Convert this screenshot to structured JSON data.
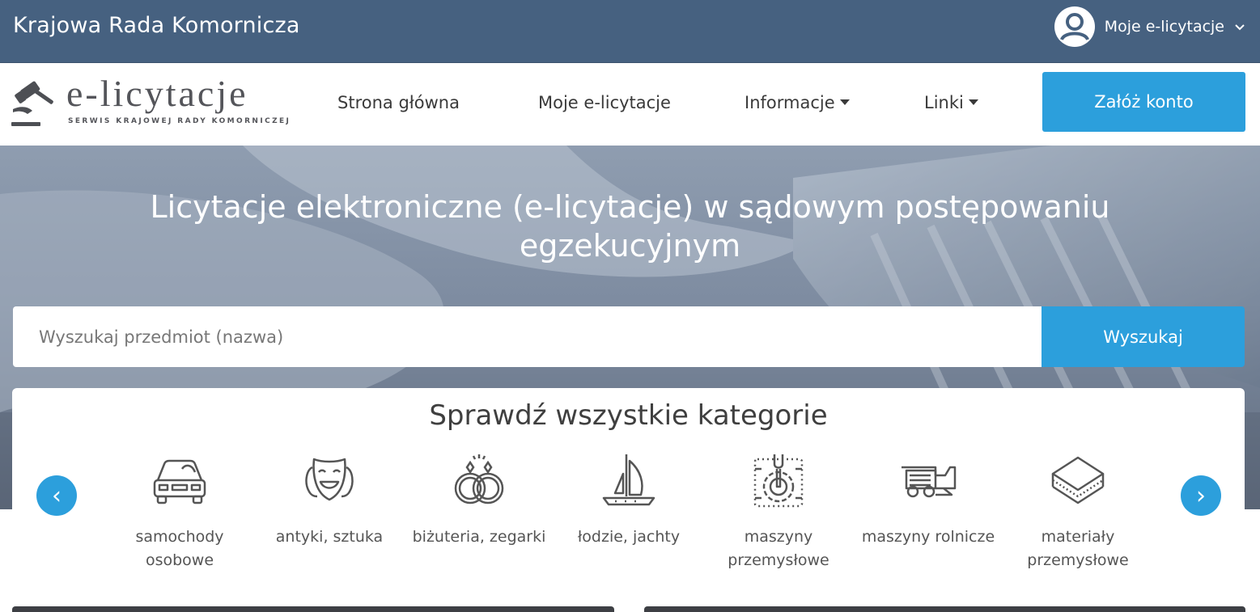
{
  "topbar": {
    "org_name": "Krajowa Rada Komornicza",
    "user_menu_label": "Moje e-licytacje",
    "avatar_icon": "user-circle-icon",
    "caret_icon": "chevron-down-icon"
  },
  "logo": {
    "wordmark": "e-licytacje",
    "tagline": "SERWIS KRAJOWEJ RADY KOMORNICZEJ",
    "icon": "gavel-icon"
  },
  "nav": {
    "items": [
      {
        "label": "Strona główna",
        "dropdown": false
      },
      {
        "label": "Moje e-licytacje",
        "dropdown": false
      },
      {
        "label": "Informacje",
        "dropdown": true
      },
      {
        "label": "Linki",
        "dropdown": true
      }
    ],
    "register_label": "Załóż konto"
  },
  "hero": {
    "title": "Licytacje elektroniczne (e-licytacje) w sądowym postępowaniu egzekucyjnym"
  },
  "search": {
    "placeholder": "Wyszukaj przedmiot (nazwa)",
    "value": "",
    "button_label": "Wyszukaj"
  },
  "categories": {
    "title": "Sprawdź wszystkie kategorie",
    "prev_label": "‹",
    "next_label": "›",
    "items": [
      {
        "label": "samochody osobowe",
        "icon": "car-icon"
      },
      {
        "label": "antyki, sztuka",
        "icon": "theater-masks-icon"
      },
      {
        "label": "biżuteria, zegarki",
        "icon": "rings-icon"
      },
      {
        "label": "łodzie, jachty",
        "icon": "sailboat-icon"
      },
      {
        "label": "maszyny przemysłowe",
        "icon": "industrial-machine-icon"
      },
      {
        "label": "maszyny rolnicze",
        "icon": "harvester-icon"
      },
      {
        "label": "materiały przemysłowe",
        "icon": "layers-icon"
      }
    ]
  },
  "colors": {
    "topbar": "#466180",
    "accent": "#2c9fdc",
    "text": "#3a3a3a"
  }
}
